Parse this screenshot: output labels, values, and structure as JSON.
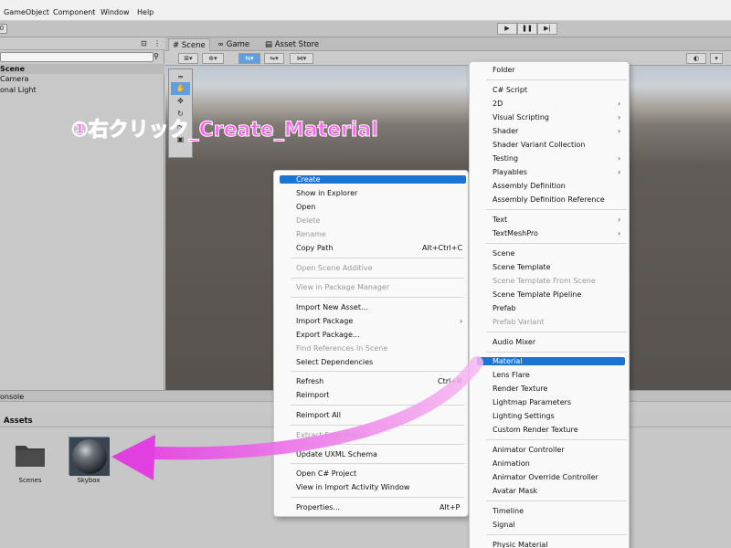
{
  "menubar": {
    "items": [
      "GameObject",
      "Component",
      "Window",
      "Help"
    ]
  },
  "toolbar": {
    "left_glyph": "0",
    "play": "▶",
    "pause": "❚❚",
    "step": "▶|"
  },
  "hierarchy": {
    "scene": "Scene",
    "camera": "Camera",
    "light": "onal Light",
    "search_icon": "⚲",
    "lock_icon": "⊡",
    "menu_icon": "⋮"
  },
  "scene_tabs": [
    "# Scene",
    "∞ Game",
    "▤ Asset Store"
  ],
  "scene_toolbar": {
    "gizmo": "2D",
    "light": "☼",
    "audio": "♪",
    "fx": "ꟷ",
    "right_gizmo": "◐"
  },
  "tools": [
    "═",
    "✋",
    "✥",
    "↻",
    "⇱",
    "▣"
  ],
  "annotation": "①右クリック_Create_Material",
  "bottom": {
    "console_tab": "onsole",
    "assets_label": "Assets"
  },
  "assets": [
    {
      "label": "Scenes"
    },
    {
      "label": "Skybox"
    }
  ],
  "context_menu": {
    "items": [
      {
        "label": "Create",
        "state": "highlight"
      },
      {
        "label": "Show in Explorer"
      },
      {
        "label": "Open"
      },
      {
        "label": "Delete",
        "state": "disabled"
      },
      {
        "label": "Rename",
        "state": "disabled"
      },
      {
        "label": "Copy Path",
        "shortcut": "Alt+Ctrl+C"
      },
      {
        "label": "Open Scene Additive",
        "state": "disabled"
      },
      {
        "label": "View in Package Manager",
        "state": "disabled"
      },
      {
        "label": "Import New Asset..."
      },
      {
        "label": "Import Package",
        "submenu": true
      },
      {
        "label": "Export Package..."
      },
      {
        "label": "Find References In Scene",
        "state": "disabled"
      },
      {
        "label": "Select Dependencies"
      },
      {
        "label": "Refresh",
        "shortcut": "Ctrl+R"
      },
      {
        "label": "Reimport"
      },
      {
        "label": "Reimport All"
      },
      {
        "label": "Extract From Prefab",
        "state": "disabled"
      },
      {
        "label": "Update UXML Schema"
      },
      {
        "label": "Open C# Project"
      },
      {
        "label": "View in Import Activity Window"
      },
      {
        "label": "Properties...",
        "shortcut": "Alt+P"
      }
    ]
  },
  "create_menu": {
    "items": [
      {
        "label": "Folder"
      },
      {
        "label": "C# Script"
      },
      {
        "label": "2D",
        "submenu": true
      },
      {
        "label": "Visual Scripting",
        "submenu": true
      },
      {
        "label": "Shader",
        "submenu": true
      },
      {
        "label": "Shader Variant Collection"
      },
      {
        "label": "Testing",
        "submenu": true
      },
      {
        "label": "Playables",
        "submenu": true
      },
      {
        "label": "Assembly Definition"
      },
      {
        "label": "Assembly Definition Reference"
      },
      {
        "label": "Text",
        "submenu": true
      },
      {
        "label": "TextMeshPro",
        "submenu": true
      },
      {
        "label": "Scene"
      },
      {
        "label": "Scene Template"
      },
      {
        "label": "Scene Template From Scene",
        "state": "disabled"
      },
      {
        "label": "Scene Template Pipeline"
      },
      {
        "label": "Prefab"
      },
      {
        "label": "Prefab Variant",
        "state": "disabled"
      },
      {
        "label": "Audio Mixer"
      },
      {
        "label": "Material",
        "state": "highlight"
      },
      {
        "label": "Lens Flare"
      },
      {
        "label": "Render Texture"
      },
      {
        "label": "Lightmap Parameters"
      },
      {
        "label": "Lighting Settings"
      },
      {
        "label": "Custom Render Texture"
      },
      {
        "label": "Animator Controller"
      },
      {
        "label": "Animation"
      },
      {
        "label": "Animator Override Controller"
      },
      {
        "label": "Avatar Mask"
      },
      {
        "label": "Timeline"
      },
      {
        "label": "Signal"
      },
      {
        "label": "Physic Material"
      }
    ]
  },
  "colors": {
    "highlight": "#1a74d2",
    "annotation": "#ff66ee",
    "arrow": "#e23fe0"
  }
}
